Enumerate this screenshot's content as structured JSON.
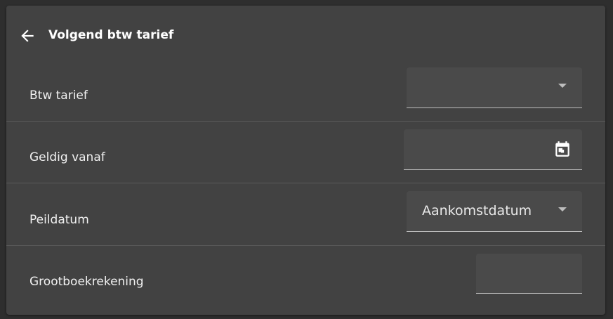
{
  "header": {
    "title": "Volgend btw tarief",
    "back_icon": "arrow-left-icon"
  },
  "rows": [
    {
      "label": "Btw tarief",
      "value": "",
      "control": "select"
    },
    {
      "label": "Geldig vanaf",
      "value": "",
      "control": "date",
      "icon": "calendar-icon"
    },
    {
      "label": "Peildatum",
      "value": "Aankomstdatum",
      "control": "select"
    },
    {
      "label": "Grootboekrekening",
      "value": "",
      "control": "text"
    }
  ],
  "colors": {
    "background": "#2e2e2e",
    "card": "#424242",
    "field": "#4a4a4a",
    "text": "#f0f0f0"
  }
}
